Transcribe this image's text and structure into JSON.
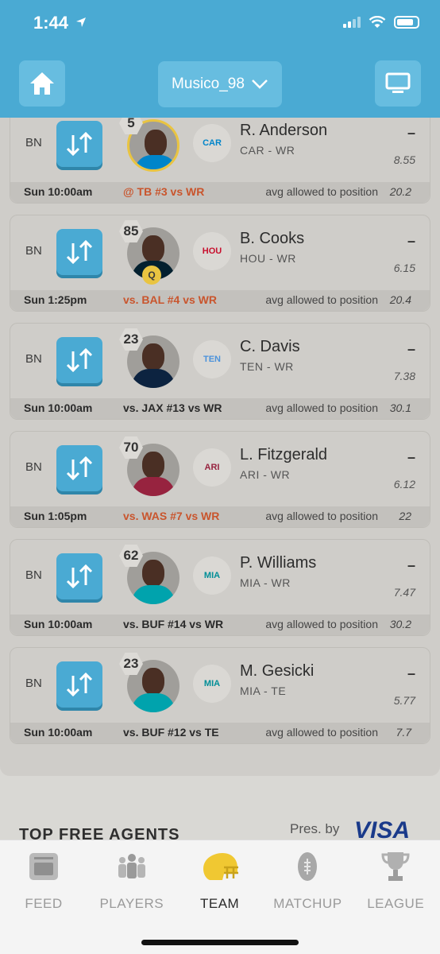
{
  "status_bar": {
    "time": "1:44"
  },
  "header": {
    "team_name": "Musico_98"
  },
  "roster": [
    {
      "slot": "BN",
      "rank": "5",
      "name": "R. Anderson",
      "team_pos": "CAR - WR",
      "score": "–",
      "proj": "8.55",
      "game_time": "Sun 10:00am",
      "matchup": "@ TB #3 vs WR",
      "matchup_tone": "bad",
      "avg_label": "avg allowed to position",
      "avg_value": "20.2",
      "team_abbr": "CAR",
      "team_color": "#0085ca",
      "jersey_color": "#0085ca"
    },
    {
      "slot": "BN",
      "rank": "85",
      "name": "B. Cooks",
      "team_pos": "HOU - WR",
      "score": "–",
      "proj": "6.15",
      "game_time": "Sun 1:25pm",
      "matchup": "vs. BAL #4 vs WR",
      "matchup_tone": "bad",
      "avg_label": "avg allowed to position",
      "avg_value": "20.4",
      "status_badge": "Q",
      "team_abbr": "HOU",
      "team_color": "#c8102e",
      "jersey_color": "#03202f"
    },
    {
      "slot": "BN",
      "rank": "23",
      "name": "C. Davis",
      "team_pos": "TEN - WR",
      "score": "–",
      "proj": "7.38",
      "game_time": "Sun 10:00am",
      "matchup": "vs. JAX #13 vs WR",
      "matchup_tone": "neutral",
      "avg_label": "avg allowed to position",
      "avg_value": "30.1",
      "team_abbr": "TEN",
      "team_color": "#4b92db",
      "jersey_color": "#0c2340"
    },
    {
      "slot": "BN",
      "rank": "70",
      "name": "L. Fitzgerald",
      "team_pos": "ARI - WR",
      "score": "–",
      "proj": "6.12",
      "game_time": "Sun 1:05pm",
      "matchup": "vs. WAS #7 vs WR",
      "matchup_tone": "bad",
      "avg_label": "avg allowed to position",
      "avg_value": "22",
      "team_abbr": "ARI",
      "team_color": "#97233f",
      "jersey_color": "#97233f"
    },
    {
      "slot": "BN",
      "rank": "62",
      "name": "P. Williams",
      "team_pos": "MIA - WR",
      "score": "–",
      "proj": "7.47",
      "game_time": "Sun 10:00am",
      "matchup": "vs. BUF #14 vs WR",
      "matchup_tone": "neutral",
      "avg_label": "avg allowed to position",
      "avg_value": "30.2",
      "team_abbr": "MIA",
      "team_color": "#008e97",
      "jersey_color": "#00a3ad"
    },
    {
      "slot": "BN",
      "rank": "23",
      "name": "M. Gesicki",
      "team_pos": "MIA - TE",
      "score": "–",
      "proj": "5.77",
      "game_time": "Sun 10:00am",
      "matchup": "vs. BUF #12 vs TE",
      "matchup_tone": "neutral",
      "avg_label": "avg allowed to position",
      "avg_value": "7.7",
      "team_abbr": "MIA",
      "team_color": "#008e97",
      "jersey_color": "#00a3ad"
    }
  ],
  "free_agents": {
    "heading": "TOP FREE AGENTS",
    "sponsor_prefix": "Pres. by",
    "sponsor": "VISA"
  },
  "tabs": [
    {
      "label": "FEED",
      "icon": "feed-icon",
      "active": false
    },
    {
      "label": "PLAYERS",
      "icon": "players-icon",
      "active": false
    },
    {
      "label": "TEAM",
      "icon": "helmet-icon",
      "active": true
    },
    {
      "label": "MATCHUP",
      "icon": "football-icon",
      "active": false
    },
    {
      "label": "LEAGUE",
      "icon": "trophy-icon",
      "active": false
    }
  ],
  "colors": {
    "accent": "#4aaad3",
    "bad_matchup": "#c9552d",
    "active_tab_icon": "#f0c832"
  }
}
